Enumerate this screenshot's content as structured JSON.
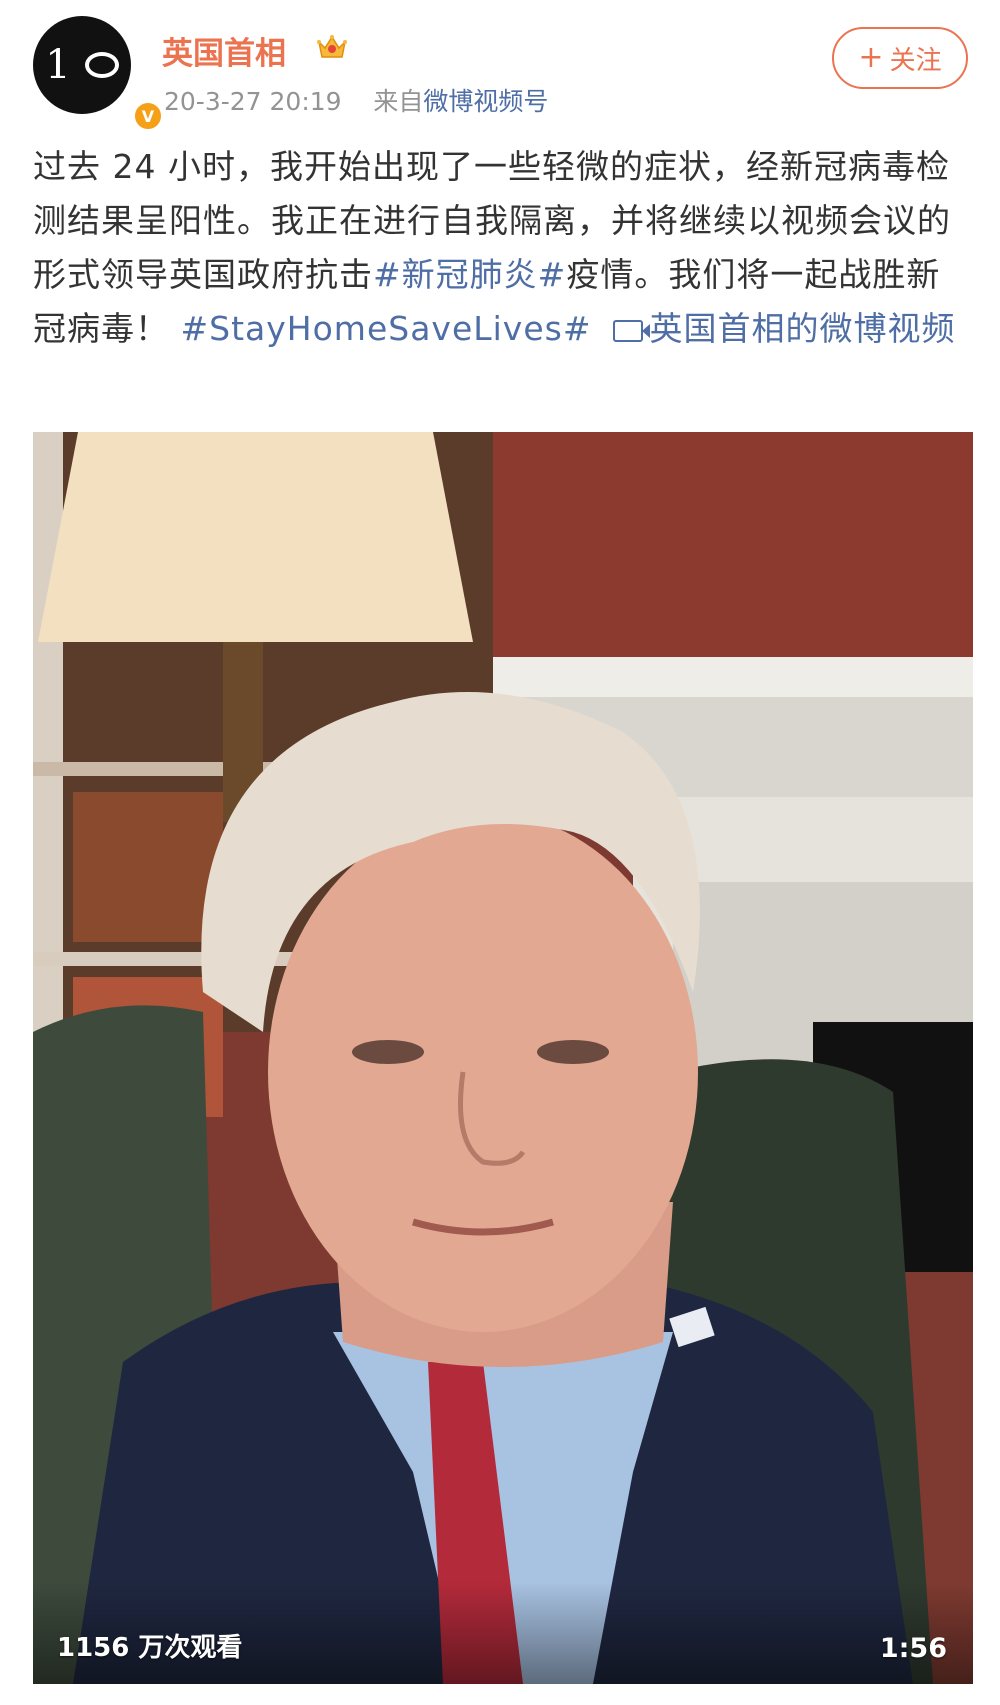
{
  "post": {
    "author": "英国首相",
    "timestamp": "20-3-27 20:19",
    "source_prefix": "来自",
    "source": "微博视频号",
    "follow_label": "关注",
    "avatar_text": "10",
    "verified_mark": "V",
    "text": {
      "part1": "过去 24 小时，我开始出现了一些轻微的症状，经新冠病毒检测结果呈阳性。我正在进行自我隔离，并将继续以视频会议的形式领导英国政府抗击",
      "hashtag1": "#新冠肺炎#",
      "part2": "疫情。我们将一起战胜新冠病毒！",
      "hashtag2": "#StayHomeSaveLives#",
      "video_link": "英国首相的微博视频"
    }
  },
  "video": {
    "view_count": "1156 万次观看",
    "duration": "1:56"
  },
  "colors": {
    "author": "#eb7350",
    "link": "#4e6ea5",
    "meta": "#939393"
  },
  "icons": {
    "verified": "verified-badge-icon",
    "crown": "crown-icon",
    "follow": "plus-icon",
    "video_link": "video-camera-icon"
  }
}
